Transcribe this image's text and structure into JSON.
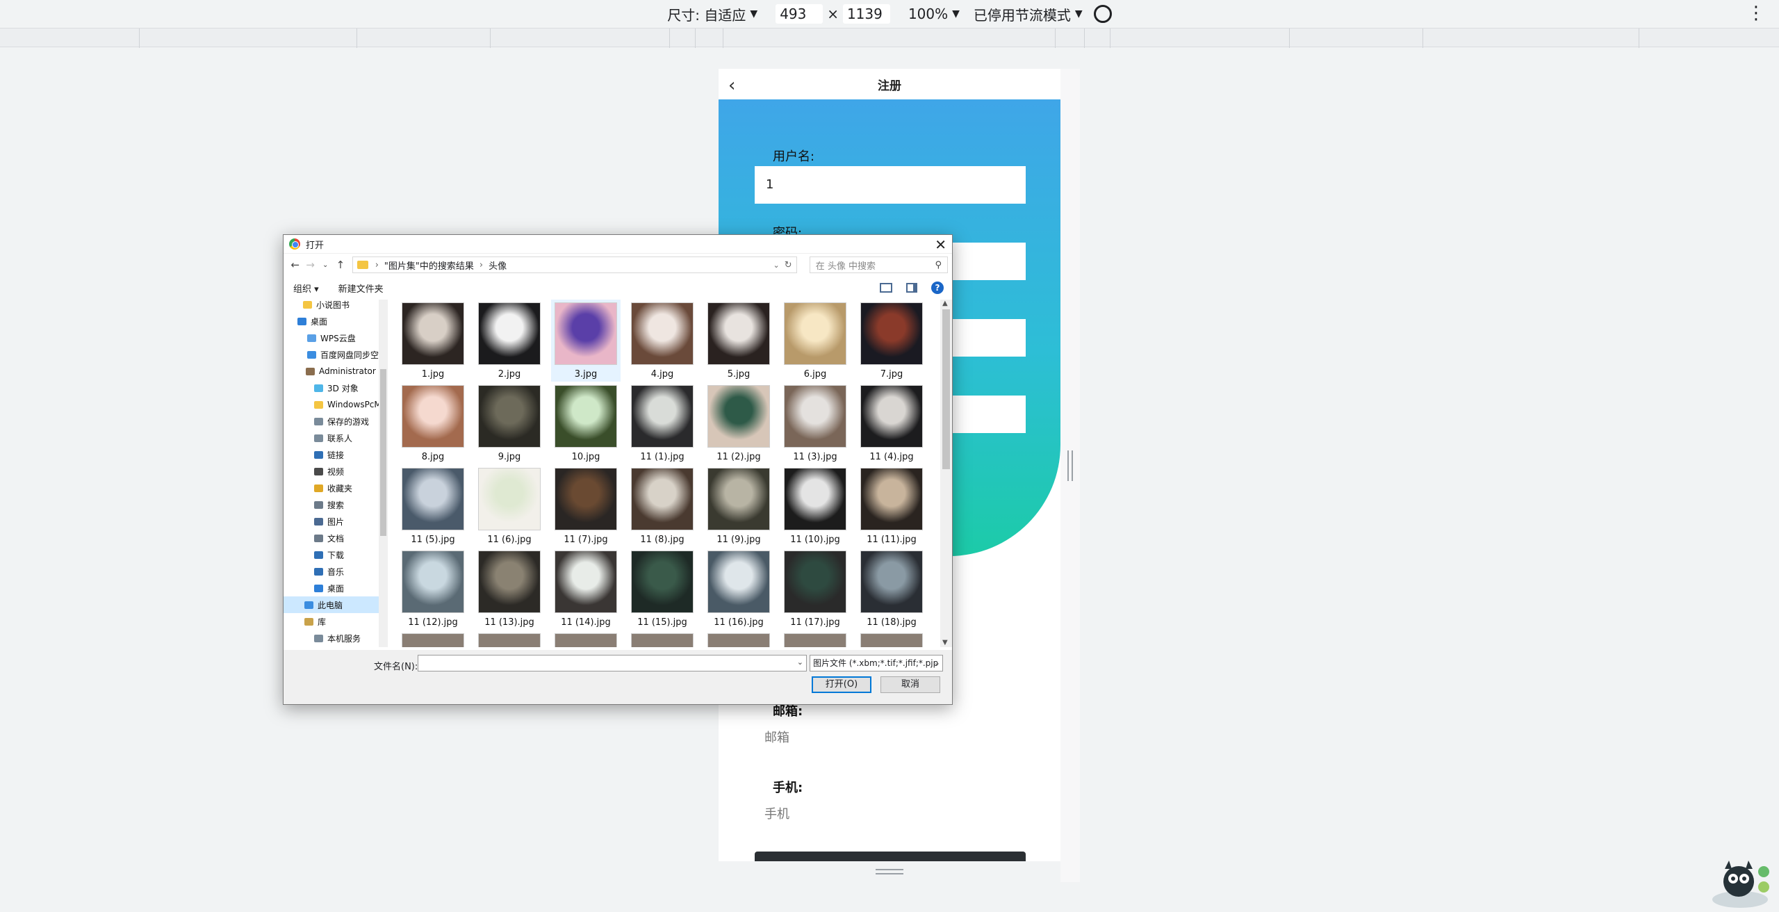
{
  "devtools": {
    "size_label": "尺寸: 自适应",
    "width": "493",
    "times": "×",
    "height": "1139",
    "zoom": "100%",
    "throttle": "已停用节流模式"
  },
  "phone": {
    "title": "注册",
    "username_label": "用户名:",
    "username_value": "1",
    "password_label": "密码:",
    "email_label": "邮箱:",
    "email_placeholder": "邮箱",
    "phone_label": "手机:",
    "phone_placeholder": "手机"
  },
  "dialog": {
    "title": "打开",
    "breadcrumb": [
      "\"图片集\"中的搜索结果",
      "头像"
    ],
    "search_placeholder": "在 头像 中搜索",
    "toolbar": {
      "organize": "组织 ▾",
      "new_folder": "新建文件夹"
    },
    "tree": [
      {
        "label": "小说图书",
        "color": "#f4c542"
      },
      {
        "label": "桌面",
        "color": "#2e7fd8"
      },
      {
        "label": "WPS云盘",
        "color": "#5aa0e6"
      },
      {
        "label": "百度网盘同步空",
        "color": "#3b8de0"
      },
      {
        "label": "Administrator",
        "color": "#8a6d4e"
      },
      {
        "label": "3D 对象",
        "color": "#4fb6e8"
      },
      {
        "label": "WindowsPcM",
        "color": "#f4c542"
      },
      {
        "label": "保存的游戏",
        "color": "#7a8b9a"
      },
      {
        "label": "联系人",
        "color": "#7a8b9a"
      },
      {
        "label": "链接",
        "color": "#2f6fb5"
      },
      {
        "label": "视频",
        "color": "#4a4a4a"
      },
      {
        "label": "收藏夹",
        "color": "#e0a826"
      },
      {
        "label": "搜索",
        "color": "#6c7a89"
      },
      {
        "label": "图片",
        "color": "#4b6a92"
      },
      {
        "label": "文档",
        "color": "#6c7a89"
      },
      {
        "label": "下载",
        "color": "#2f6fb5"
      },
      {
        "label": "音乐",
        "color": "#2f6fb5"
      },
      {
        "label": "桌面",
        "color": "#2e7fd8"
      },
      {
        "label": "此电脑",
        "color": "#3b8de0"
      },
      {
        "label": "库",
        "color": "#c9a24a"
      },
      {
        "label": "本机服务",
        "color": "#7a8b9a"
      }
    ],
    "files": [
      {
        "name": "1.jpg",
        "c1": "#d8cfc6",
        "c2": "#2c2522"
      },
      {
        "name": "2.jpg",
        "c1": "#f2f2f2",
        "c2": "#1b1b1d"
      },
      {
        "name": "3.jpg",
        "c1": "#5a3fa8",
        "c2": "#e9b6c8"
      },
      {
        "name": "4.jpg",
        "c1": "#efe6e1",
        "c2": "#6a4a3a"
      },
      {
        "name": "5.jpg",
        "c1": "#e8e3df",
        "c2": "#2a2220"
      },
      {
        "name": "6.jpg",
        "c1": "#f7e7c4",
        "c2": "#b89a6a"
      },
      {
        "name": "7.jpg",
        "c1": "#8a3a2a",
        "c2": "#1a1a22"
      },
      {
        "name": "8.jpg",
        "c1": "#f5d9cf",
        "c2": "#a36a4e"
      },
      {
        "name": "9.jpg",
        "c1": "#6d6a5a",
        "c2": "#2b2a24"
      },
      {
        "name": "10.jpg",
        "c1": "#cfe8c8",
        "c2": "#3a4e2a"
      },
      {
        "name": "11 (1).jpg",
        "c1": "#d9dcd8",
        "c2": "#2a2a2c"
      },
      {
        "name": "11 (2).jpg",
        "c1": "#2e5a48",
        "c2": "#d7c6b8"
      },
      {
        "name": "11 (3).jpg",
        "c1": "#e4e1de",
        "c2": "#7a6658"
      },
      {
        "name": "11 (4).jpg",
        "c1": "#d9d6d2",
        "c2": "#1c1c1e"
      },
      {
        "name": "11 (5).jpg",
        "c1": "#c9d2dc",
        "c2": "#4a5a6a"
      },
      {
        "name": "11 (6).jpg",
        "c1": "#dfe9d2",
        "c2": "#f2f0ea"
      },
      {
        "name": "11 (7).jpg",
        "c1": "#6a4a32",
        "c2": "#2a2624"
      },
      {
        "name": "11 (8).jpg",
        "c1": "#d8d2c8",
        "c2": "#4a3a30"
      },
      {
        "name": "11 (9).jpg",
        "c1": "#b8b4a4",
        "c2": "#3a3a30"
      },
      {
        "name": "11 (10).jpg",
        "c1": "#e4e4e4",
        "c2": "#1c1c1c"
      },
      {
        "name": "11 (11).jpg",
        "c1": "#c8b49c",
        "c2": "#2a2420"
      },
      {
        "name": "11 (12).jpg",
        "c1": "#c9d8e0",
        "c2": "#5a6a74"
      },
      {
        "name": "11 (13).jpg",
        "c1": "#8a8272",
        "c2": "#2c2a26"
      },
      {
        "name": "11 (14).jpg",
        "c1": "#e8ece8",
        "c2": "#3a3634"
      },
      {
        "name": "11 (15).jpg",
        "c1": "#3a5a4a",
        "c2": "#1e2a26"
      },
      {
        "name": "11 (16).jpg",
        "c1": "#dfe6ea",
        "c2": "#4a5a66"
      },
      {
        "name": "11 (17).jpg",
        "c1": "#2e4a40",
        "c2": "#2a2a2a"
      },
      {
        "name": "11 (18).jpg",
        "c1": "#8a9aa4",
        "c2": "#2a2e34"
      }
    ],
    "filename_label": "文件名(N):",
    "filename_value": "",
    "filetype": "图片文件 (*.xbm;*.tif;*.jfif;*.pjp",
    "open_label": "打开(O)",
    "cancel_label": "取消"
  }
}
